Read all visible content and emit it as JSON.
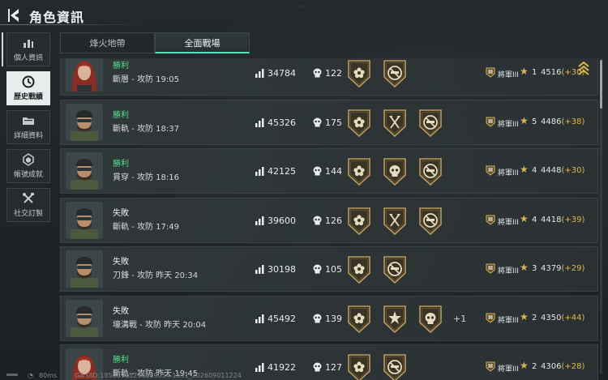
{
  "header": {
    "title": "角色資訊"
  },
  "sidebar": {
    "items": [
      {
        "label": "個人資訊",
        "icon": "bar-chart-icon",
        "active": false
      },
      {
        "label": "歷史戰績",
        "icon": "clock-icon",
        "active": true
      },
      {
        "label": "詳細資料",
        "icon": "folder-icon",
        "active": false
      },
      {
        "label": "帳號成就",
        "icon": "medal-icon",
        "active": false
      },
      {
        "label": "社交訂製",
        "icon": "tools-icon",
        "active": false
      }
    ]
  },
  "tabs": [
    {
      "label": "烽火地帶",
      "active": false
    },
    {
      "label": "全面戰場",
      "active": true
    }
  ],
  "matches": [
    {
      "result": "勝利",
      "outcome": "win",
      "mode": "斷層 - 攻防 19:05",
      "avatar": "female",
      "score": "34784",
      "kills": "122",
      "badges": [
        "flower",
        "no-gun"
      ],
      "extra": "",
      "rank": "將軍III",
      "pos": "1",
      "rating": "4516",
      "delta": "(+30)",
      "chevron": true
    },
    {
      "result": "勝利",
      "outcome": "win",
      "mode": "斷軌 - 攻防 18:37",
      "avatar": "male",
      "score": "45326",
      "kills": "175",
      "badges": [
        "flower",
        "axe",
        "no-gun"
      ],
      "extra": "",
      "rank": "將軍III",
      "pos": "5",
      "rating": "4486",
      "delta": "(+38)",
      "chevron": false
    },
    {
      "result": "勝利",
      "outcome": "win",
      "mode": "貫穿 - 攻防 18:16",
      "avatar": "male",
      "score": "42125",
      "kills": "144",
      "badges": [
        "flower",
        "skull",
        "no-gun"
      ],
      "extra": "",
      "rank": "將軍III",
      "pos": "4",
      "rating": "4448",
      "delta": "(+30)",
      "chevron": false
    },
    {
      "result": "失敗",
      "outcome": "loss",
      "mode": "斷軌 - 攻防 17:49",
      "avatar": "male",
      "score": "39600",
      "kills": "126",
      "badges": [
        "flower",
        "axe",
        "no-gun"
      ],
      "extra": "",
      "rank": "將軍III",
      "pos": "4",
      "rating": "4418",
      "delta": "(+39)",
      "chevron": false
    },
    {
      "result": "失敗",
      "outcome": "loss",
      "mode": "刀鋒 - 攻防 昨天 20:34",
      "avatar": "male",
      "score": "30198",
      "kills": "105",
      "badges": [
        "flower",
        "no-gun"
      ],
      "extra": "",
      "rank": "將軍III",
      "pos": "3",
      "rating": "4379",
      "delta": "(+29)",
      "chevron": false
    },
    {
      "result": "失敗",
      "outcome": "loss",
      "mode": "壕溝戰 - 攻防 昨天 20:04",
      "avatar": "male",
      "score": "45492",
      "kills": "139",
      "badges": [
        "flower",
        "burst",
        "skull"
      ],
      "extra": "+1",
      "rank": "將軍III",
      "pos": "2",
      "rating": "4350",
      "delta": "(+44)",
      "chevron": false
    },
    {
      "result": "勝利",
      "outcome": "win",
      "mode": "斷軌 - 攻防 昨天 19:45",
      "avatar": "female",
      "score": "41922",
      "kills": "127",
      "badges": [
        "flower",
        "no-gun"
      ],
      "extra": "",
      "rank": "將軍III",
      "pos": "2",
      "rating": "4306",
      "delta": "(+28)",
      "chevron": false
    }
  ],
  "footer": {
    "ping": "80ms",
    "uid": "GA UID:18586965298589054 1631_202609011224"
  },
  "colors": {
    "win": "#55e08a",
    "accent": "#55e0c0",
    "delta": "#e0b84a",
    "gold": "#d8b45a"
  }
}
